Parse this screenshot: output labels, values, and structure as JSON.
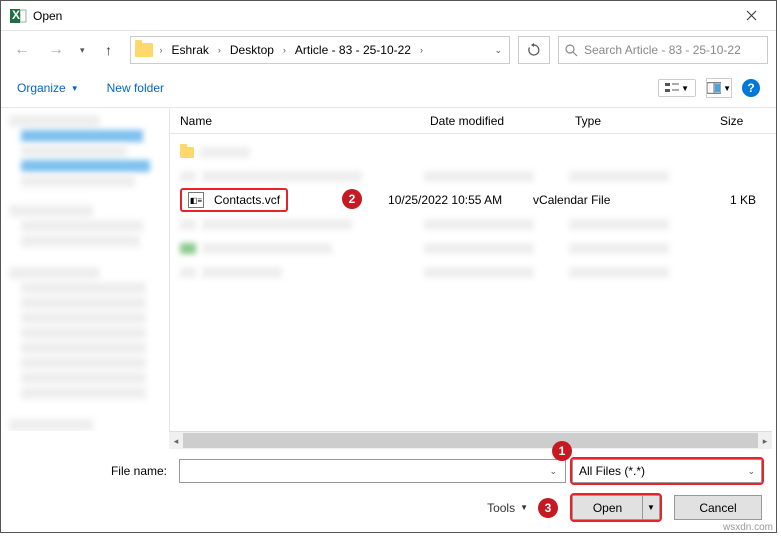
{
  "dialog": {
    "title": "Open"
  },
  "nav": {
    "breadcrumbs": [
      "Eshrak",
      "Desktop",
      "Article - 83 - 25-10-22"
    ]
  },
  "search": {
    "placeholder": "Search Article - 83 - 25-10-22"
  },
  "toolbar": {
    "organize": "Organize",
    "new_folder": "New folder"
  },
  "columns": {
    "name": "Name",
    "date": "Date modified",
    "type": "Type",
    "size": "Size"
  },
  "files": {
    "contacts": {
      "name": "Contacts.vcf",
      "date": "10/25/2022 10:55 AM",
      "type": "vCalendar File",
      "size": "1 KB"
    }
  },
  "footer": {
    "filename_label": "File name:",
    "filename_value": "",
    "filter": "All Files (*.*)",
    "tools": "Tools",
    "open": "Open",
    "cancel": "Cancel"
  },
  "markers": {
    "m1": "1",
    "m2": "2",
    "m3": "3"
  },
  "watermark": "wsxdn.com"
}
